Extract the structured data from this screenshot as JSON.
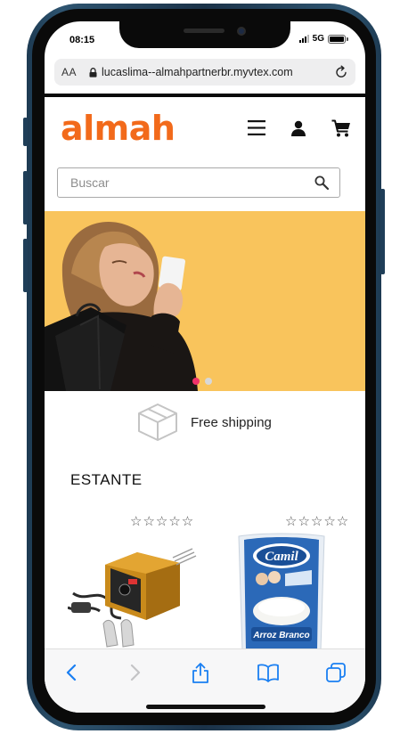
{
  "status_bar": {
    "time": "08:15",
    "network": "5G"
  },
  "browser": {
    "text_size_label": "AA",
    "url": "lucaslima--almahpartnerbr.myvtex.com"
  },
  "store": {
    "logo": "almah",
    "brand_color": "#f26a1b",
    "search": {
      "placeholder": "Buscar"
    },
    "header_icons": [
      "menu-icon",
      "user-icon",
      "cart-icon"
    ]
  },
  "hero": {
    "background": "#f9c45c",
    "slides_count": 2,
    "active_slide": 1,
    "active_dot_color": "#f0326a"
  },
  "shipping": {
    "label": "Free shipping"
  },
  "shelf": {
    "title": "ESTANTE",
    "products": [
      {
        "rating_display": "☆☆☆☆☆",
        "image": "welding-machine"
      },
      {
        "rating_display": "☆☆☆☆☆",
        "image": "camil-rice-bag",
        "brand_text": "Camil",
        "product_text": "Arroz Branco"
      }
    ]
  },
  "toolbar": {
    "buttons": [
      "back-icon",
      "forward-icon",
      "share-icon",
      "bookmarks-icon",
      "tabs-icon"
    ],
    "accent": "#1a7ff2"
  }
}
